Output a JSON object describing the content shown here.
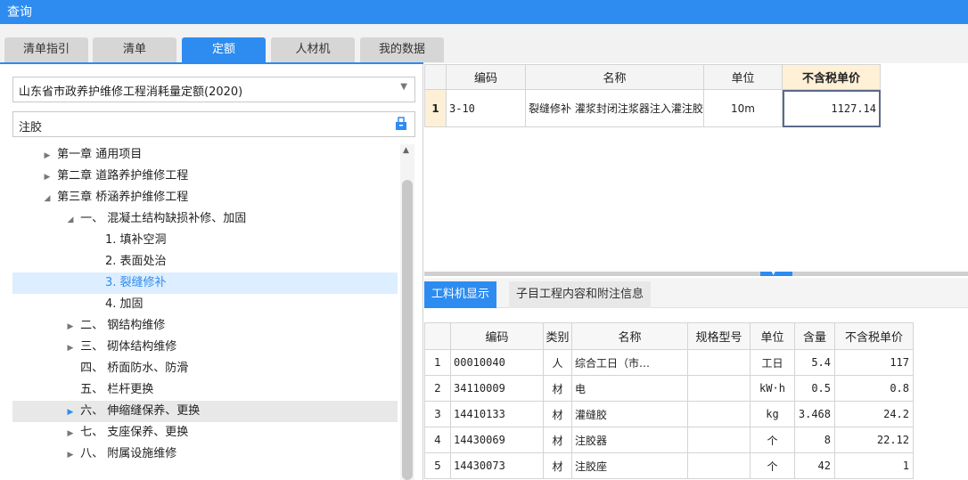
{
  "window": {
    "title": "查询"
  },
  "tabs": [
    {
      "label": "清单指引",
      "active": false
    },
    {
      "label": "清单",
      "active": false
    },
    {
      "label": "定额",
      "active": true
    },
    {
      "label": "人材机",
      "active": false
    },
    {
      "label": "我的数据",
      "active": false
    }
  ],
  "selector": {
    "value": "山东省市政养护维修工程消耗量定额(2020)"
  },
  "search": {
    "value": "注胶"
  },
  "tree": [
    {
      "label": "第一章 通用项目",
      "toggle": "▶"
    },
    {
      "label": "第二章 道路养护维修工程",
      "toggle": "▶"
    },
    {
      "label": "第三章 桥涵养护维修工程",
      "toggle": "◢"
    },
    {
      "label": "一、 混凝土结构缺损补修、加固",
      "toggle": "◢"
    },
    {
      "label": "1. 填补空洞",
      "toggle": ""
    },
    {
      "label": "2. 表面处治",
      "toggle": ""
    },
    {
      "label": "3. 裂缝修补",
      "toggle": "",
      "state": "selected"
    },
    {
      "label": "4. 加固",
      "toggle": ""
    },
    {
      "label": "二、 钢结构维修",
      "toggle": "▶"
    },
    {
      "label": "三、 砌体结构维修",
      "toggle": "▶"
    },
    {
      "label": "四、 桥面防水、防滑",
      "toggle": ""
    },
    {
      "label": "五、 栏杆更换",
      "toggle": ""
    },
    {
      "label": "六、 伸缩缝保养、更换",
      "toggle": "▶",
      "state": "hover"
    },
    {
      "label": "七、 支座保养、更换",
      "toggle": "▶"
    },
    {
      "label": "八、 附属设施维修",
      "toggle": "▶"
    }
  ],
  "quota_table": {
    "headers": {
      "code": "编码",
      "name": "名称",
      "unit": "单位",
      "price": "不含税单价"
    },
    "rows": [
      {
        "index": "1",
        "code": "3-10",
        "name": "裂缝修补 灌浆封闭注浆器注入灌注胶",
        "unit": "10m",
        "price": "1127.14"
      }
    ]
  },
  "subtabs": [
    {
      "label": "工料机显示",
      "active": true
    },
    {
      "label": "子目工程内容和附注信息",
      "active": false
    }
  ],
  "material_table": {
    "headers": {
      "code": "编码",
      "type": "类别",
      "name": "名称",
      "spec": "规格型号",
      "unit": "单位",
      "qty": "含量",
      "price": "不含税单价"
    },
    "rows": [
      {
        "index": "1",
        "code": "00010040",
        "type": "人",
        "name": "综合工日（市…",
        "spec": "",
        "unit": "工日",
        "qty": "5.4",
        "price": "117"
      },
      {
        "index": "2",
        "code": "34110009",
        "type": "材",
        "name": "电",
        "spec": "",
        "unit": "kW·h",
        "qty": "0.5",
        "price": "0.8"
      },
      {
        "index": "3",
        "code": "14410133",
        "type": "材",
        "name": "灌缝胶",
        "spec": "",
        "unit": "kg",
        "qty": "3.468",
        "price": "24.2"
      },
      {
        "index": "4",
        "code": "14430069",
        "type": "材",
        "name": "注胶器",
        "spec": "",
        "unit": "个",
        "qty": "8",
        "price": "22.12"
      },
      {
        "index": "5",
        "code": "14430073",
        "type": "材",
        "name": "注胶座",
        "spec": "",
        "unit": "个",
        "qty": "42",
        "price": "1"
      }
    ]
  },
  "colors": {
    "accent": "#2e8cf0",
    "selected_row_bg": "#dceeff",
    "header_highlight": "#fff0d6"
  }
}
